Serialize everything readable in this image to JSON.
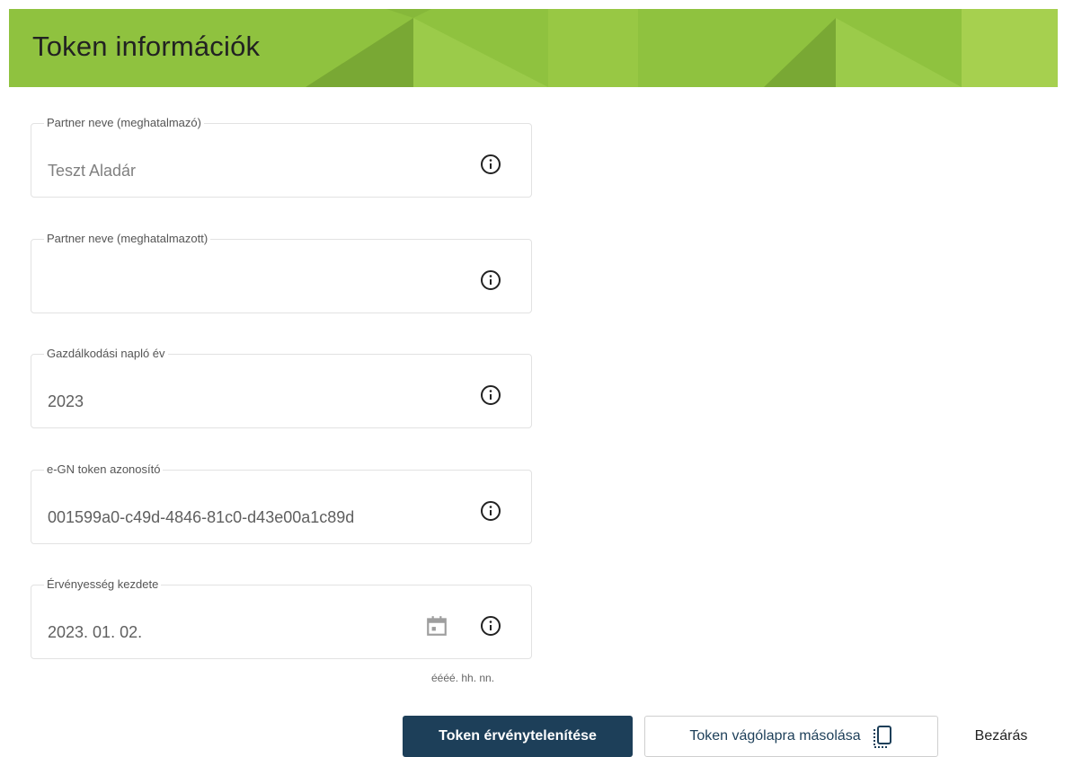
{
  "header": {
    "title": "Token információk"
  },
  "fields": [
    {
      "label": "Partner neve (meghatalmazó)",
      "value": "Teszt Aladár",
      "icon": "info-icon"
    },
    {
      "label": "Partner neve (meghatalmazott)",
      "value": "",
      "icon": "info-icon"
    },
    {
      "label": "Gazdálkodási napló év",
      "value": "2023",
      "icon": "info-icon"
    },
    {
      "label": "e-GN token azonosító",
      "value": "001599a0-c49d-4846-81c0-d43e00a1c89d",
      "icon": "info-icon"
    },
    {
      "label": "Érvényesség kezdete",
      "value": "2023. 01. 02.",
      "icon": "info-icon",
      "extra_icon": "calendar-icon",
      "hint": "éééé. hh. nn."
    }
  ],
  "actions": {
    "invalidate_label": "Token érvénytelenítése",
    "copy_label": "Token vágólapra másolása",
    "close_label": "Bezárás"
  },
  "colors": {
    "header_green": "#8fc23f",
    "primary_button": "#1d3f59"
  }
}
